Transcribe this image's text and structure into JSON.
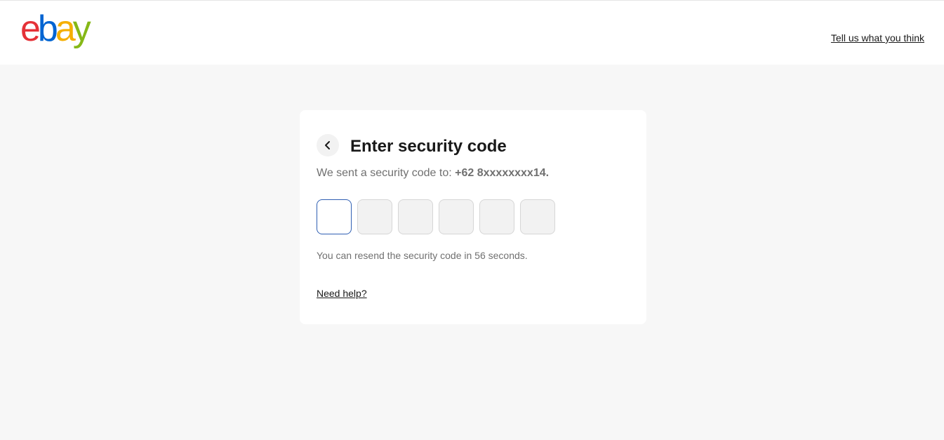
{
  "header": {
    "logo_letters": [
      {
        "char": "e",
        "color": "#e53238"
      },
      {
        "char": "b",
        "color": "#0064d2"
      },
      {
        "char": "a",
        "color": "#f5af02"
      },
      {
        "char": "y",
        "color": "#86b817"
      }
    ],
    "feedback_link": "Tell us what you think"
  },
  "card": {
    "back_icon": "chevron-left-icon",
    "title": "Enter security code",
    "sent_prefix": "We sent a security code to: ",
    "sent_number": "+62 8xxxxxxxx14.",
    "code_inputs": [
      "",
      "",
      "",
      "",
      "",
      ""
    ],
    "resend_text": "You can resend the security code in 56 seconds.",
    "help_link": "Need help?"
  },
  "colors": {
    "page_background": "#f7f7f7",
    "focus_border": "#2f5fb3",
    "muted_text": "#707070"
  }
}
